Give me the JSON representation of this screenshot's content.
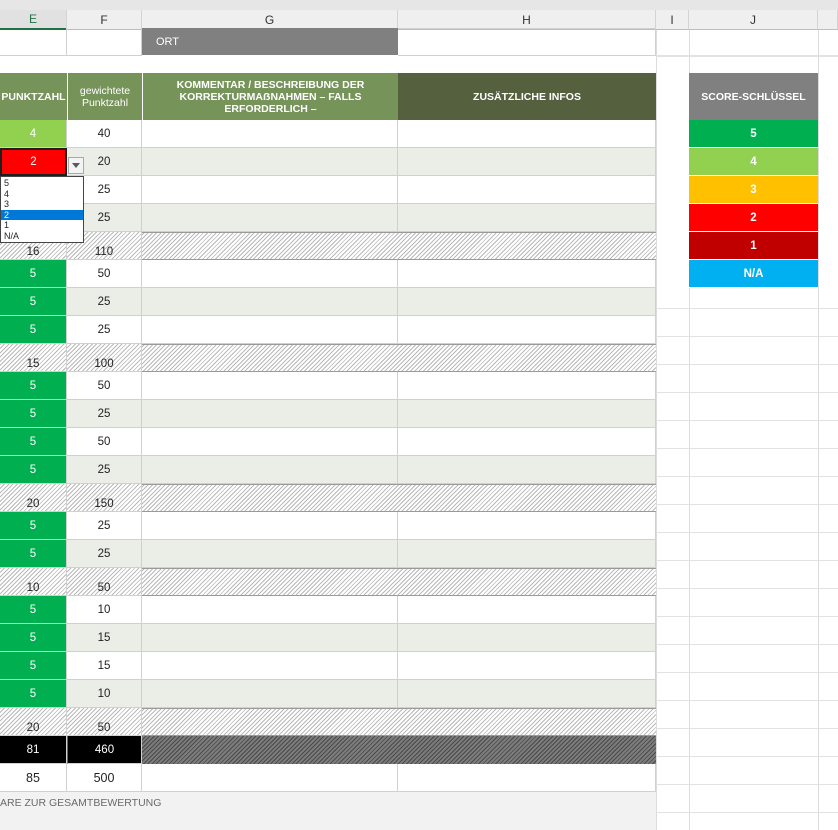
{
  "columns": {
    "E": "E",
    "F": "F",
    "G": "G",
    "H": "H",
    "I": "I",
    "J": "J"
  },
  "location_label": "ORT",
  "headers": {
    "score": "PUNKTZAHL",
    "weighted": "gewichtete Punktzahl",
    "comment": "KOMMENTAR / BESCHREIBUNG DER KORREKTURMAẞNAHMEN – FALLS ERFORDERLICH –",
    "info": "ZUSÄTZLICHE INFOS"
  },
  "score_rows": [
    {
      "score": "4",
      "weighted": "40",
      "grade": "4",
      "kind": "item"
    },
    {
      "score": "2",
      "weighted": "20",
      "grade": "2",
      "kind": "item"
    },
    {
      "score": "",
      "weighted": "25",
      "grade": "",
      "kind": "item"
    },
    {
      "score": "",
      "weighted": "25",
      "grade": "",
      "kind": "item"
    },
    {
      "score": "16",
      "weighted": "110",
      "kind": "subtotal"
    },
    {
      "score": "5",
      "weighted": "50",
      "grade": "5",
      "kind": "item"
    },
    {
      "score": "5",
      "weighted": "25",
      "grade": "5",
      "kind": "item"
    },
    {
      "score": "5",
      "weighted": "25",
      "grade": "5",
      "kind": "item"
    },
    {
      "score": "15",
      "weighted": "100",
      "kind": "subtotal"
    },
    {
      "score": "5",
      "weighted": "50",
      "grade": "5",
      "kind": "item"
    },
    {
      "score": "5",
      "weighted": "25",
      "grade": "5",
      "kind": "item"
    },
    {
      "score": "5",
      "weighted": "50",
      "grade": "5",
      "kind": "item"
    },
    {
      "score": "5",
      "weighted": "25",
      "grade": "5",
      "kind": "item"
    },
    {
      "score": "20",
      "weighted": "150",
      "kind": "subtotal"
    },
    {
      "score": "5",
      "weighted": "25",
      "grade": "5",
      "kind": "item"
    },
    {
      "score": "5",
      "weighted": "25",
      "grade": "5",
      "kind": "item"
    },
    {
      "score": "10",
      "weighted": "50",
      "kind": "subtotal"
    },
    {
      "score": "5",
      "weighted": "10",
      "grade": "5",
      "kind": "item"
    },
    {
      "score": "5",
      "weighted": "15",
      "grade": "5",
      "kind": "item"
    },
    {
      "score": "5",
      "weighted": "15",
      "grade": "5",
      "kind": "item"
    },
    {
      "score": "5",
      "weighted": "10",
      "grade": "5",
      "kind": "item"
    },
    {
      "score": "20",
      "weighted": "50",
      "kind": "subtotal"
    }
  ],
  "total": {
    "score": "81",
    "weighted": "460"
  },
  "max": {
    "score": "85",
    "weighted": "500"
  },
  "overall_comment_label": "ARE ZUR GESAMTBEWERTUNG",
  "dropdown": {
    "options": [
      "5",
      "4",
      "3",
      "2",
      "1",
      "N/A"
    ],
    "selected": "2"
  },
  "score_key": {
    "title": "SCORE-SCHLÜSSEL",
    "items": [
      {
        "label": "5",
        "color": "#00b050"
      },
      {
        "label": "4",
        "color": "#92d050"
      },
      {
        "label": "3",
        "color": "#ffc000"
      },
      {
        "label": "2",
        "color": "#ff0000"
      },
      {
        "label": "1",
        "color": "#c00000"
      },
      {
        "label": "N/A",
        "color": "#00b0f0"
      }
    ]
  },
  "colors": {
    "header_green_light": "#76935a",
    "header_green_dark": "#55603f",
    "location_gray": "#808080",
    "key_header_gray": "#808080",
    "total_black": "#000000"
  }
}
